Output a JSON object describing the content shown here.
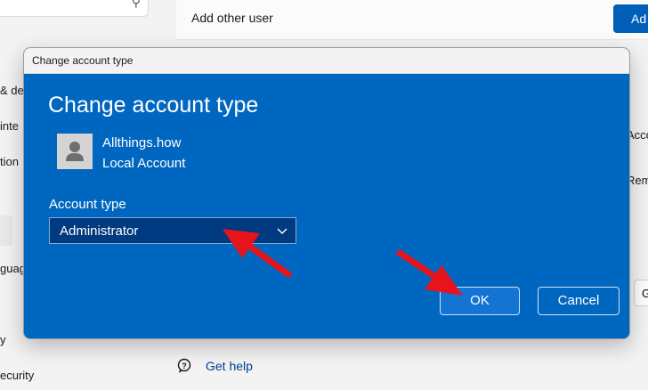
{
  "background": {
    "nav_items": [
      "& de",
      "inte",
      "tion",
      "guag",
      "y",
      "ecurity"
    ],
    "add_other_user_label": "Add other user",
    "add_button_label": "Ad",
    "right_edge_items": [
      "Acco",
      "Rem"
    ],
    "right_edge_button_label": "G",
    "get_help_label": "Get help"
  },
  "dialog": {
    "window_title": "Change account type",
    "heading": "Change account type",
    "user": {
      "name": "Allthings.how",
      "type": "Local Account"
    },
    "account_type_label": "Account type",
    "account_type_selected": "Administrator",
    "ok_label": "OK",
    "cancel_label": "Cancel"
  },
  "colors": {
    "dialog_bg": "#0067c0",
    "select_bg": "#003a80",
    "arrow_red": "#e8141c"
  }
}
